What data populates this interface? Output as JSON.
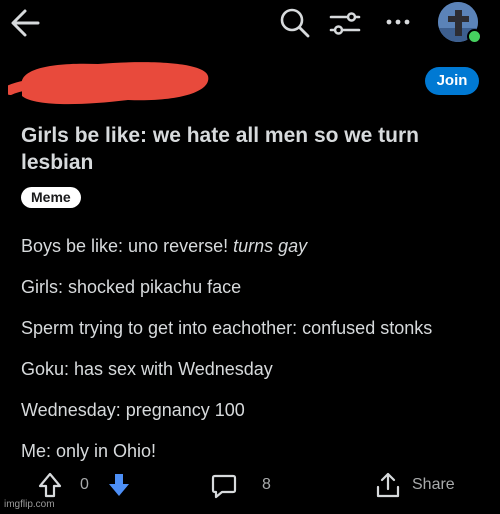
{
  "post": {
    "join_label": "Join",
    "title": "Girls be like: we hate all men so we turn lesbian",
    "flair": "Meme",
    "body": [
      {
        "text": "Boys be like: uno reverse! ",
        "italic": "turns gay"
      },
      {
        "text": "Girls: shocked pikachu face"
      },
      {
        "text": "Sperm trying to get into eachother: confused stonks"
      },
      {
        "text": "Goku: has sex with Wednesday"
      },
      {
        "text": "Wednesday: pregnancy 100"
      },
      {
        "text": "Me: only in Ohio!"
      }
    ]
  },
  "actions": {
    "score": "0",
    "comment_count": "8",
    "share_label": "Share"
  },
  "watermark": "imgflip.com",
  "colors": {
    "background": "#000000",
    "join": "#0079d3",
    "downvote": "#4d8ff6",
    "redaction": "#e84a3c"
  },
  "icons": [
    "back-arrow-icon",
    "search-icon",
    "filter-icon",
    "more-icon",
    "avatar",
    "upvote-icon",
    "downvote-icon",
    "comment-icon",
    "share-icon"
  ]
}
